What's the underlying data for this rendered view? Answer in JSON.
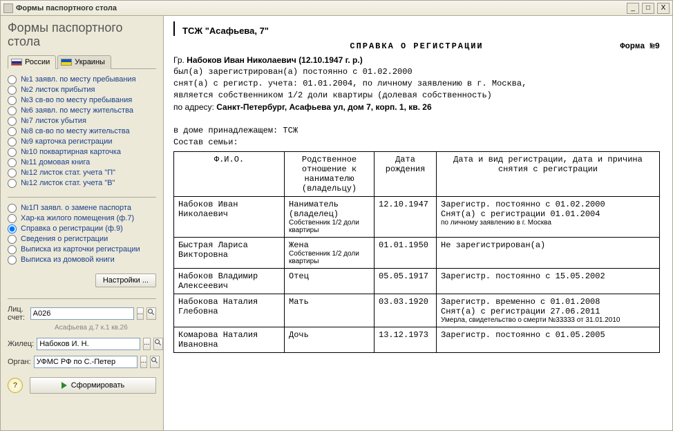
{
  "window": {
    "title": "Формы паспортного стола"
  },
  "sidebar": {
    "heading": "Формы паспортного стола",
    "tabs": {
      "ru": "России",
      "ua": "Украины"
    },
    "group1": [
      {
        "label": "№1  заявл. по месту пребывания"
      },
      {
        "label": "№2  листок прибытия"
      },
      {
        "label": "№3  св-во по месту пребывания"
      },
      {
        "label": "№6  заявл. по месту жительства"
      },
      {
        "label": "№7  листок убытия"
      },
      {
        "label": "№8  св-во по месту жительства"
      },
      {
        "label": "№9  карточка регистрации"
      },
      {
        "label": "№10  поквартирная карточка"
      },
      {
        "label": "№11  домовая книга"
      },
      {
        "label": "№12  листок стат. учета \"П\""
      },
      {
        "label": "№12  листок стат. учета \"В\""
      }
    ],
    "group2": [
      {
        "label": "№1П  заявл. о замене паспорта"
      },
      {
        "label": "Хар-ка жилого помещения (ф.7)"
      },
      {
        "label": "Справка о регистрации (ф.9)"
      },
      {
        "label": "Сведения о регистрации"
      },
      {
        "label": "Выписка из карточки регистрации"
      },
      {
        "label": "Выписка из домовой книги"
      }
    ],
    "selected_group2_index": 2,
    "settings_label": "Настройки ...",
    "account_label": "Лиц. счет:",
    "account_value": "А026",
    "account_hint": "Асафьева д.7 к.1 кв.26",
    "resident_label": "Жилец:",
    "resident_value": "Набоков И. Н.",
    "organ_label": "Орган:",
    "organ_value": "УФМС РФ по С.-Петер",
    "generate_label": "Сформировать"
  },
  "doc": {
    "org": "ТСЖ \"Асафьева, 7\"",
    "title": "СПРАВКА О РЕГИСТРАЦИИ",
    "form_no": "Форма №9",
    "citizen_prefix": "Гр. ",
    "citizen_name": "Набоков Иван Николаевич (12.10.1947 г. р.)",
    "line_reg": "был(а) зарегистрирован(а) постоянно с 01.02.2000",
    "line_snat": "снят(а) с регистр. учета: 01.01.2004, по личному заявлению в г. Москва,",
    "line_own": "является собственником 1/2 доли квартиры (долевая собственность)",
    "addr_prefix": "по адресу: ",
    "addr": "Санкт-Петербург, Асафьева ул, дом 7, корп. 1, кв. 26",
    "house_line": "в доме принадлежащем:  ТСЖ",
    "family_title": "Состав семьи:",
    "headers": {
      "fio": "Ф.И.О.",
      "rel": "Родственное отношение к нанимателю (владельцу)",
      "dob": "Дата рождения",
      "reg": "Дата и вид регистрации,\nдата и причина снятия с регистрации"
    },
    "rows": [
      {
        "fio": "Набоков Иван Николаевич",
        "rel": "Наниматель (владелец)",
        "rel_note": "Собственник 1/2 доли квартиры",
        "dob": "12.10.1947",
        "reg1": "Зарегистр. постоянно с 01.02.2000",
        "reg2": "Снят(а) с регистрации  01.01.2004",
        "reg_note": "по личному заявлению в г. Москва"
      },
      {
        "fio": "Быстрая Лариса Викторовна",
        "rel": "Жена",
        "rel_note": "Собственник 1/2 доли квартиры",
        "dob": "01.01.1950",
        "reg1": "Не зарегистрирован(а)",
        "reg2": "",
        "reg_note": ""
      },
      {
        "fio": "Набоков Владимир Алексеевич",
        "rel": "Отец",
        "rel_note": "",
        "dob": "05.05.1917",
        "reg1": "Зарегистр. постоянно с 15.05.2002",
        "reg2": "",
        "reg_note": ""
      },
      {
        "fio": "Набокова Наталия Глебовна",
        "rel": "Мать",
        "rel_note": "",
        "dob": "03.03.1920",
        "reg1": "Зарегистр. временно с 01.01.2008",
        "reg2": "Снят(а) с регистрации  27.06.2011",
        "reg_note": "Умерла, свидетельство о смерти №33333 от 31.01.2010"
      },
      {
        "fio": "Комарова Наталия Ивановна",
        "rel": "Дочь",
        "rel_note": "",
        "dob": "13.12.1973",
        "reg1": "Зарегистр. постоянно с 01.05.2005",
        "reg2": "",
        "reg_note": ""
      }
    ]
  }
}
